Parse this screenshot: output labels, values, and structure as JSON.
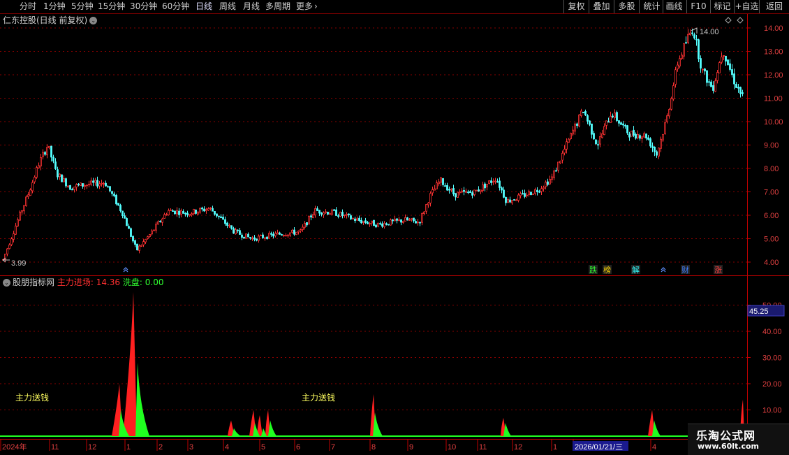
{
  "toolbar": {
    "periods": [
      {
        "label": "分时",
        "active": false
      },
      {
        "label": "1分钟",
        "active": false
      },
      {
        "label": "5分钟",
        "active": false
      },
      {
        "label": "15分钟",
        "active": false
      },
      {
        "label": "30分钟",
        "active": false
      },
      {
        "label": "60分钟",
        "active": false
      },
      {
        "label": "日线",
        "active": true
      },
      {
        "label": "周线",
        "active": false
      },
      {
        "label": "月线",
        "active": false
      },
      {
        "label": "多周期",
        "active": false
      },
      {
        "label": "更多",
        "active": false
      }
    ],
    "right_buttons": [
      "复权",
      "叠加",
      "多股",
      "统计",
      "画线",
      "F10",
      "标记",
      "+自选",
      "返回"
    ]
  },
  "main_chart": {
    "title": "仁东控股(日线 前复权)",
    "high_label": "14.00",
    "low_label": "3.99",
    "y_ticks": [
      "14.00",
      "13.00",
      "12.00",
      "11.00",
      "10.00",
      "9.00",
      "8.00",
      "7.00",
      "6.00",
      "5.00",
      "4.00"
    ],
    "markers": [
      "跌",
      "榜",
      "解",
      "财",
      "涨"
    ],
    "colors": {
      "up": "#ff3333",
      "down": "#54ffff",
      "grid": "#8a0000",
      "axis": "#c00000"
    }
  },
  "indicator": {
    "name": "股朋指标网",
    "series1_label": "主力进场: 14.36",
    "series2_label": "洗盘: 0.00",
    "annotations": [
      "主力送钱",
      "主力送钱"
    ],
    "y_ticks": [
      "50.00",
      "40.00",
      "30.00",
      "20.00",
      "10.00"
    ],
    "current_value": "45.25",
    "colors": {
      "entry": "#ff2020",
      "wash": "#20ff20"
    }
  },
  "x_axis": {
    "labels": [
      "2024年",
      "11",
      "12",
      "1",
      "2",
      "3",
      "4",
      "5",
      "6",
      "7",
      "8",
      "9",
      "10",
      "11",
      "12",
      "1",
      "2026/01/21/三",
      "4"
    ]
  },
  "watermark": {
    "name": "乐淘公式网",
    "url": "www.60lt.com"
  }
}
